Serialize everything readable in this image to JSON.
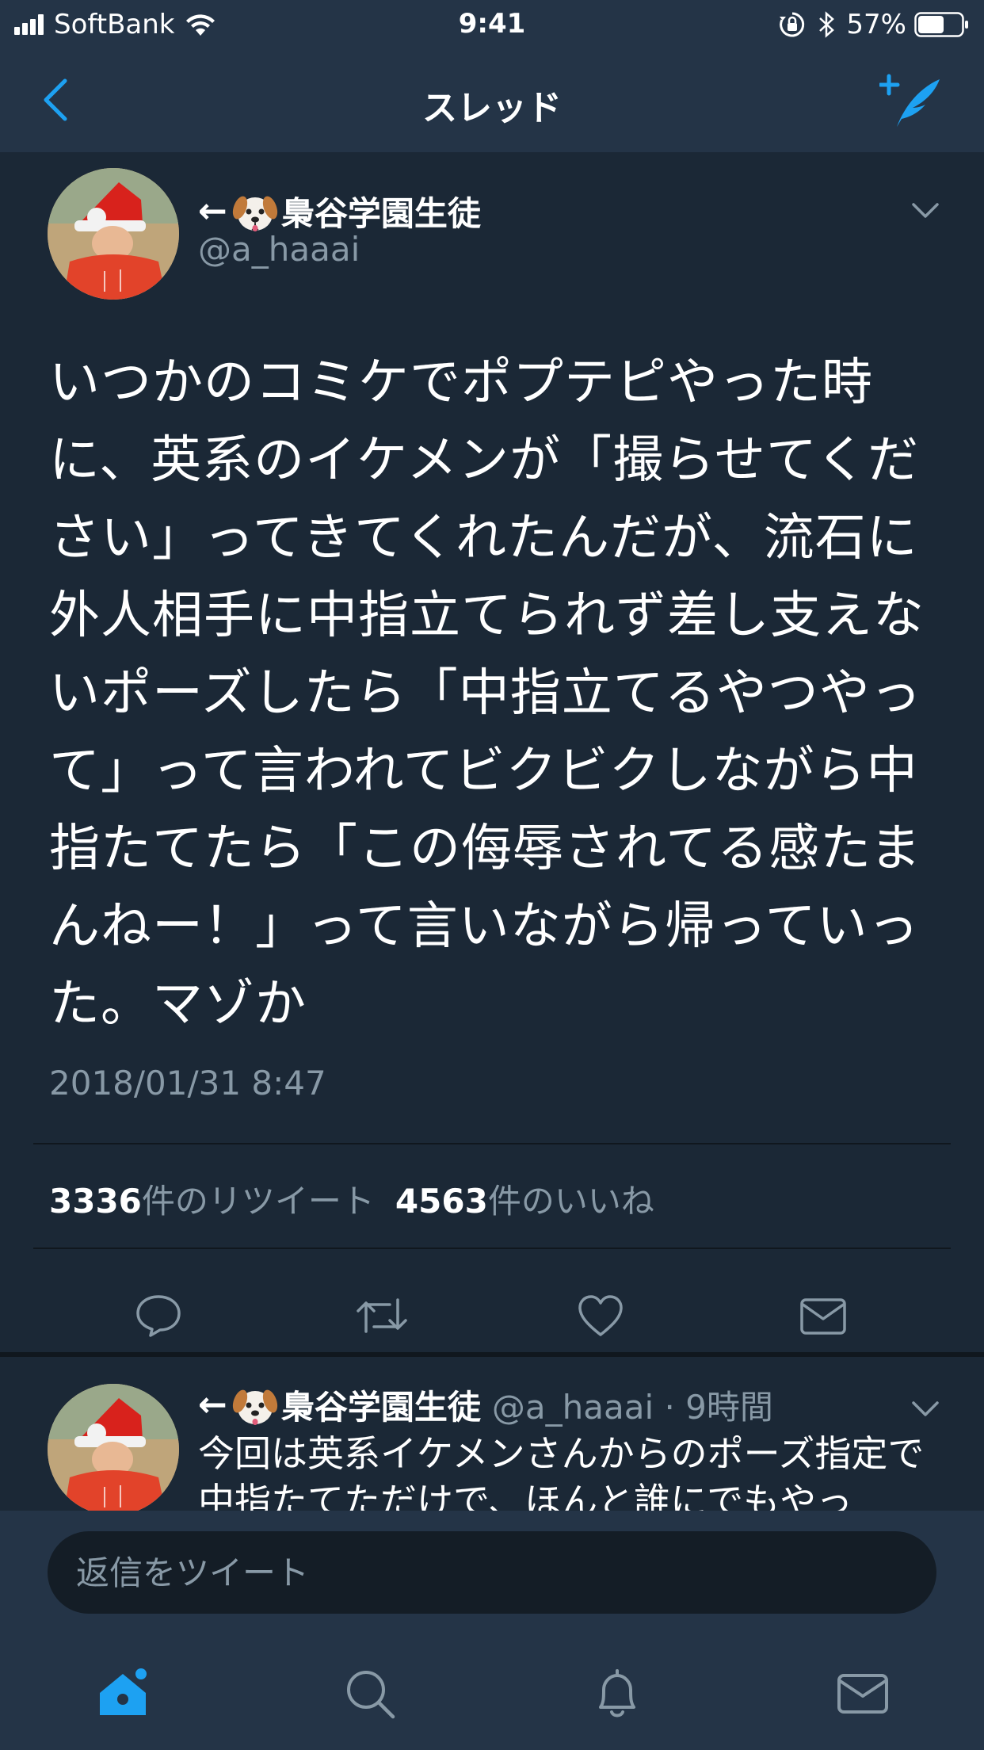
{
  "status_bar": {
    "carrier": "SoftBank",
    "time": "9:41",
    "battery": "57%",
    "icons": [
      "signal-icon",
      "wifi-icon",
      "rotation-lock-icon",
      "bluetooth-icon",
      "battery-icon"
    ]
  },
  "nav": {
    "title": "スレッド",
    "back_icon": "chevron-left-icon",
    "compose_icon": "compose-tweet-icon"
  },
  "tweet": {
    "arrow": "←",
    "name": "梟谷学園生徒",
    "handle": "@a_haaai",
    "text": "いつかのコミケでポプテピやった時に、英系のイケメンが「撮らせてください」ってきてくれたんだが、流石に外人相手に中指立てられず差し支えないポーズしたら「中指立てるやつやって」って言われてビクビクしながら中指たてたら「この侮辱されてる感たまんねー！」って言いながら帰っていった。マゾか",
    "timestamp": "2018/01/31 8:47",
    "retweets": "3336",
    "retweets_label": "件のリツイート",
    "likes": "4563",
    "likes_label": "件のいいね",
    "actions": [
      "reply-icon",
      "retweet-icon",
      "like-icon",
      "dm-icon"
    ]
  },
  "reply": {
    "arrow": "←",
    "name": "梟谷学園生徒",
    "meta": "@a_haaai · 9時間",
    "text": "今回は英系イケメンさんからのポーズ指定で中指たてただけで、ほんと誰にでもやっ"
  },
  "composer": {
    "placeholder": "返信をツイート"
  },
  "tab_bar": {
    "tabs": [
      "home-icon",
      "search-icon",
      "notifications-icon",
      "messages-icon"
    ],
    "active": "home-icon",
    "colors": {
      "active": "#1da1f2",
      "inactive": "#8899a6"
    }
  },
  "colors": {
    "background": "#1b2836",
    "bars": "#243447",
    "accent": "#1da1f2",
    "secondary_text": "#8899a6"
  }
}
